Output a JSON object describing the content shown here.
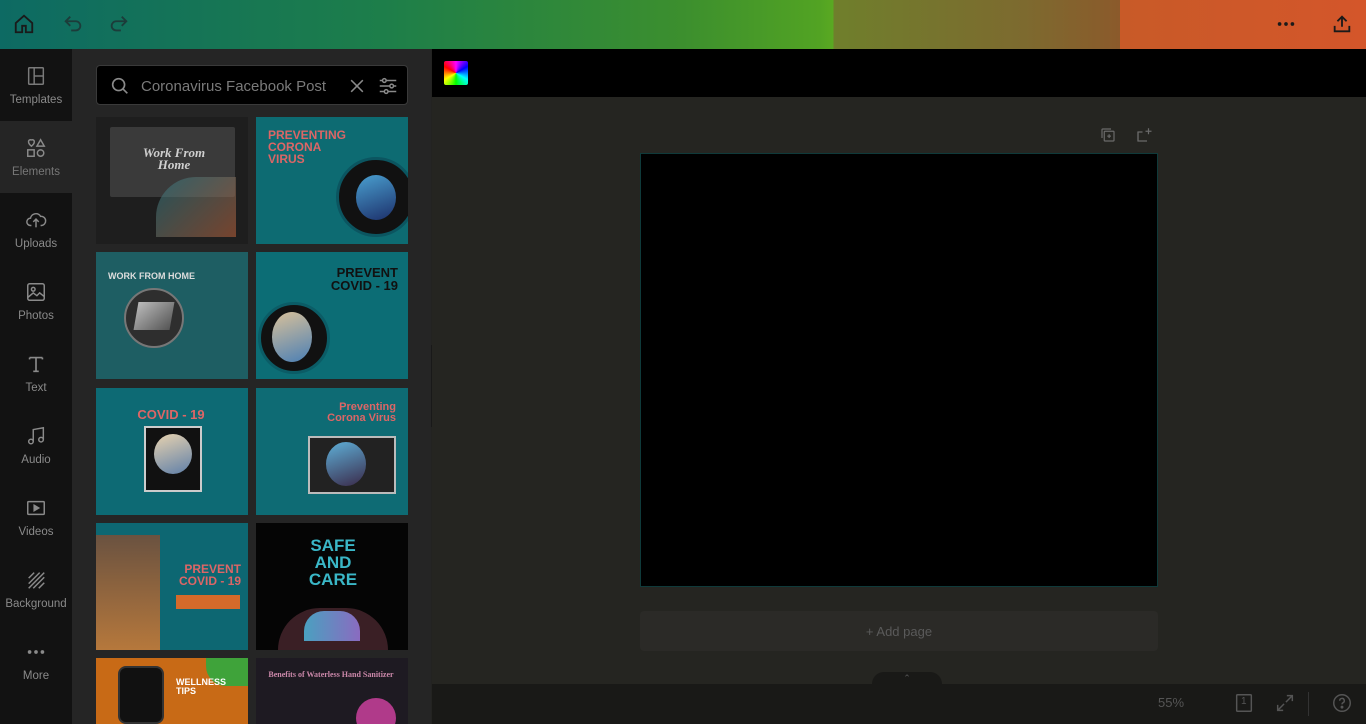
{
  "topbar": {
    "home": "home-icon",
    "undo": "undo-icon",
    "redo": "redo-icon",
    "more": "more-icon",
    "share": "share-icon"
  },
  "sidebar": {
    "items": [
      {
        "label": "Templates",
        "icon": "templates-icon"
      },
      {
        "label": "Elements",
        "icon": "elements-icon"
      },
      {
        "label": "Uploads",
        "icon": "uploads-icon"
      },
      {
        "label": "Photos",
        "icon": "photos-icon"
      },
      {
        "label": "Text",
        "icon": "text-icon"
      },
      {
        "label": "Audio",
        "icon": "audio-icon"
      },
      {
        "label": "Videos",
        "icon": "videos-icon"
      },
      {
        "label": "Background",
        "icon": "background-icon"
      },
      {
        "label": "More",
        "icon": "more-icon"
      }
    ]
  },
  "search": {
    "value": "Coronavirus Facebook Post"
  },
  "templates": [
    {
      "text": "Work From Home",
      "bg": "#1e1e1e",
      "fg": "#cfcfcf"
    },
    {
      "text": "PREVENTING CORONA VIRUS",
      "bg": "#0d6b72",
      "fg": "#e44"
    },
    {
      "text": "WORK FROM HOME",
      "bg": "#1e5e63",
      "fg": "#ddd"
    },
    {
      "text": "PREVENT COVID - 19",
      "bg": "#0c6d75",
      "fg": "#111"
    },
    {
      "text": "COVID - 19",
      "bg": "#0d6a74",
      "fg": "#e44"
    },
    {
      "text": "Preventing Corona Virus",
      "bg": "#0e6b74",
      "fg": "#e44"
    },
    {
      "text": "PREVENT COVID - 19",
      "bg": "#0d6772",
      "fg": "#e44"
    },
    {
      "text": "SAFE AND CARE",
      "bg": "#050505",
      "fg": "#3ab7c7"
    },
    {
      "text": "WELLNESS TIPS",
      "bg": "#c86a16",
      "fg": "#fff"
    },
    {
      "text": "Benefits of Waterless Hand Sanitizer",
      "bg": "#1e1a22",
      "fg": "#c8a"
    }
  ],
  "editor": {
    "add_page": "+ Add page",
    "zoom": "55%",
    "page_count": "1"
  },
  "colors": {
    "accent": "#0d6b72",
    "page_border": "#0f3a3a"
  }
}
